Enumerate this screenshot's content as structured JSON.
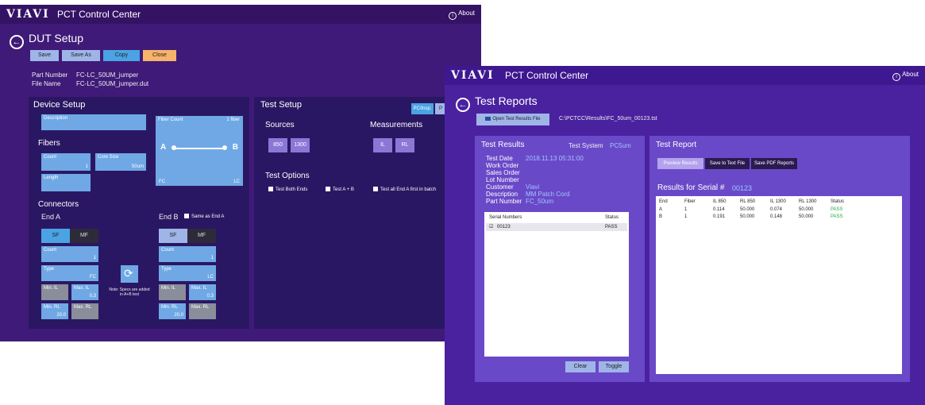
{
  "app": {
    "logo": "VIAVI",
    "title": "PCT Control Center",
    "about": "About"
  },
  "dut": {
    "header": "DUT Setup",
    "buttons": {
      "save": "Save",
      "save_as": "Save As",
      "copy": "Copy",
      "close": "Close"
    },
    "part_number_label": "Part Number",
    "part_number": "FC-LC_50UM_jumper",
    "file_name_label": "File Name",
    "file_name": "FC-LC_50UM_jumper.dut",
    "device_setup": "Device Setup",
    "description": "Description",
    "fibers": "Fibers",
    "count_label": "Count",
    "count_value": "1",
    "core_size_label": "Core Size",
    "core_size_value": "50um",
    "length_label": "Length",
    "preview": {
      "title": "Fiber Count",
      "count": "1 fiber",
      "a": "A",
      "b": "B",
      "a_conn": "FC",
      "b_conn": "LC"
    },
    "connectors": "Connectors",
    "end_a": "End A",
    "end_b": "End B",
    "same_as_end_a": "Same as End A",
    "sf": "SF",
    "mf": "MF",
    "type_label": "Type",
    "type_a": "FC",
    "type_b": "LC",
    "min_il": "Min. IL",
    "max_il": "Max. IL",
    "max_il_a": "0.3",
    "max_il_b": "0.3",
    "min_rl": "Min. RL",
    "max_rl": "Max. RL",
    "min_rl_a": "20.0",
    "min_rl_b": "20.0",
    "note": "Note: Specs are added in A+B test",
    "test_setup": "Test Setup",
    "tab_pc": "PC/Insp.",
    "tab_p": "P",
    "sources": "Sources",
    "src1": "850",
    "src2": "1300",
    "measurements": "Measurements",
    "meas1": "IL",
    "meas2": "RL",
    "test_options": "Test Options",
    "opt1": "Test Both Ends",
    "opt2": "Test A + B",
    "opt3": "Test all End A first in batch"
  },
  "reports": {
    "header": "Test Reports",
    "open_btn": "Open Test Results File",
    "path": "C:\\PCTCC\\Results\\FC_50um_00123.tst",
    "test_results": "Test Results",
    "test_system_label": "Test System",
    "test_system": "PC5um",
    "fields": [
      {
        "label": "Test Date",
        "value": "2018.11.13 05:31:00"
      },
      {
        "label": "Work Order",
        "value": ""
      },
      {
        "label": "Sales Order",
        "value": ""
      },
      {
        "label": "Lot Number",
        "value": ""
      },
      {
        "label": "Customer",
        "value": "Viavi"
      },
      {
        "label": "Description",
        "value": "MM Patch Cord"
      },
      {
        "label": "Part Number",
        "value": "FC_50um"
      }
    ],
    "serial_header": "Serial Numbers",
    "status_header": "Status",
    "serial": "00123",
    "serial_status": "PASS",
    "clear": "Clear",
    "toggle": "Toggle",
    "test_report": "Test Report",
    "preview_btn": "Preview Results",
    "save_text": "Save to Text File",
    "save_pdf": "Save PDF Reports",
    "results_for": "Results for Serial #",
    "serial_num": "00123",
    "table": {
      "headers": [
        "End",
        "Fiber",
        "IL 850",
        "RL 850",
        "IL 1300",
        "RL 1300",
        "Status"
      ],
      "rows": [
        [
          "A",
          "1",
          "0.114",
          "50.000",
          "0.074",
          "50.000",
          "PASS"
        ],
        [
          "B",
          "1",
          "0.191",
          "50.000",
          "0.148",
          "50.000",
          "PASS"
        ]
      ]
    }
  },
  "colors": {
    "bg": "#3f1a78",
    "panel": "#2a1763",
    "accent": "#4aa3e3",
    "pass": "#22aa44"
  }
}
